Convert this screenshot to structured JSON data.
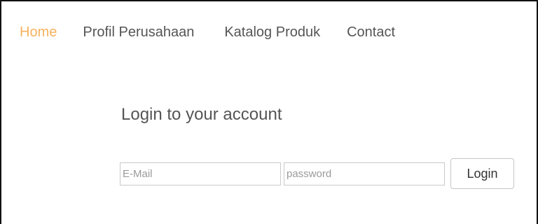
{
  "nav": {
    "items": [
      {
        "label": "Home",
        "active": true
      },
      {
        "label": "Profil Perusahaan",
        "active": false
      },
      {
        "label": "Katalog Produk",
        "active": false
      },
      {
        "label": "Contact",
        "active": false
      }
    ],
    "active_color": "#f7b15f",
    "text_color": "#555555"
  },
  "login": {
    "title": "Login to your account",
    "email_placeholder": "E-Mail",
    "password_placeholder": "password",
    "button_label": "Login"
  }
}
